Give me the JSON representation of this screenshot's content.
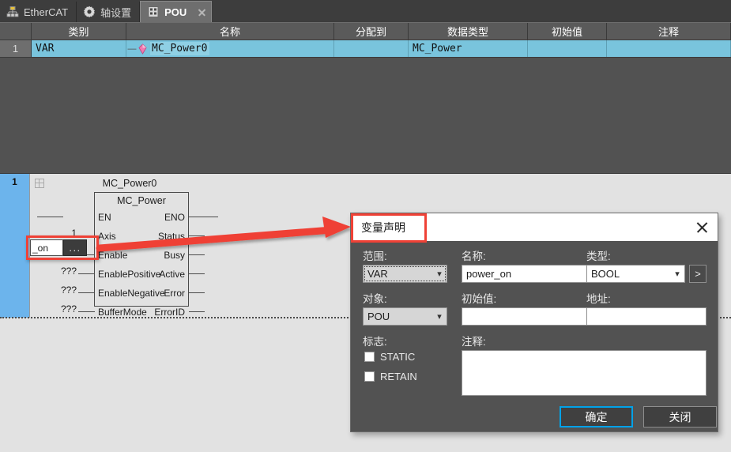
{
  "tabs": [
    {
      "label": "EtherCAT",
      "icon": "network-tree-icon",
      "active": false,
      "closable": false
    },
    {
      "label": "轴设置",
      "icon": "gear-icon",
      "active": false,
      "closable": false
    },
    {
      "label": "POU",
      "icon": "pou-icon",
      "active": true,
      "closable": true
    }
  ],
  "variable_table": {
    "columns": [
      "",
      "类别",
      "名称",
      "分配到",
      "数据类型",
      "初始值",
      "注释"
    ],
    "rows": [
      {
        "num": "1",
        "class": "VAR",
        "name": "MC_Power0",
        "assigned_to": "",
        "data_type": "MC_Power",
        "initial_value": "",
        "comment": ""
      }
    ]
  },
  "fbd": {
    "network_number": "1",
    "instance_name": "MC_Power0",
    "block_title": "MC_Power",
    "inputs": [
      {
        "name": "EN",
        "value": ""
      },
      {
        "name": "Axis",
        "value": "1"
      },
      {
        "name": "Enable",
        "value": "???"
      },
      {
        "name": "EnablePositive",
        "value": "???"
      },
      {
        "name": "EnableNegative",
        "value": "???"
      },
      {
        "name": "BufferMode",
        "value": "???"
      }
    ],
    "outputs": [
      {
        "name": "ENO"
      },
      {
        "name": "Status"
      },
      {
        "name": "Busy"
      },
      {
        "name": "Active"
      },
      {
        "name": "Error"
      },
      {
        "name": "ErrorID"
      }
    ],
    "inline_editor": {
      "text": "_on",
      "browse_label": "..."
    }
  },
  "dialog": {
    "title": "变量声明",
    "scope": {
      "label": "范围:",
      "value": "VAR"
    },
    "name": {
      "label": "名称:",
      "value": "power_on"
    },
    "type": {
      "label": "类型:",
      "value": "BOOL",
      "browse_label": ">"
    },
    "object": {
      "label": "对象:",
      "value": "POU"
    },
    "initial_value": {
      "label": "初始值:",
      "value": ""
    },
    "address": {
      "label": "地址:",
      "value": ""
    },
    "flags": {
      "label": "标志:",
      "items": [
        {
          "label": "STATIC",
          "checked": false
        },
        {
          "label": "RETAIN",
          "checked": false
        }
      ]
    },
    "comment": {
      "label": "注释:",
      "value": ""
    },
    "ok_button": "确定",
    "close_button": "关闭"
  },
  "colors": {
    "accent_blue": "#00a2e8",
    "highlight_red": "#ef4136",
    "row_cyan": "#79c4dd",
    "network_blue": "#6cb4ec",
    "panel_dark": "#525252"
  }
}
